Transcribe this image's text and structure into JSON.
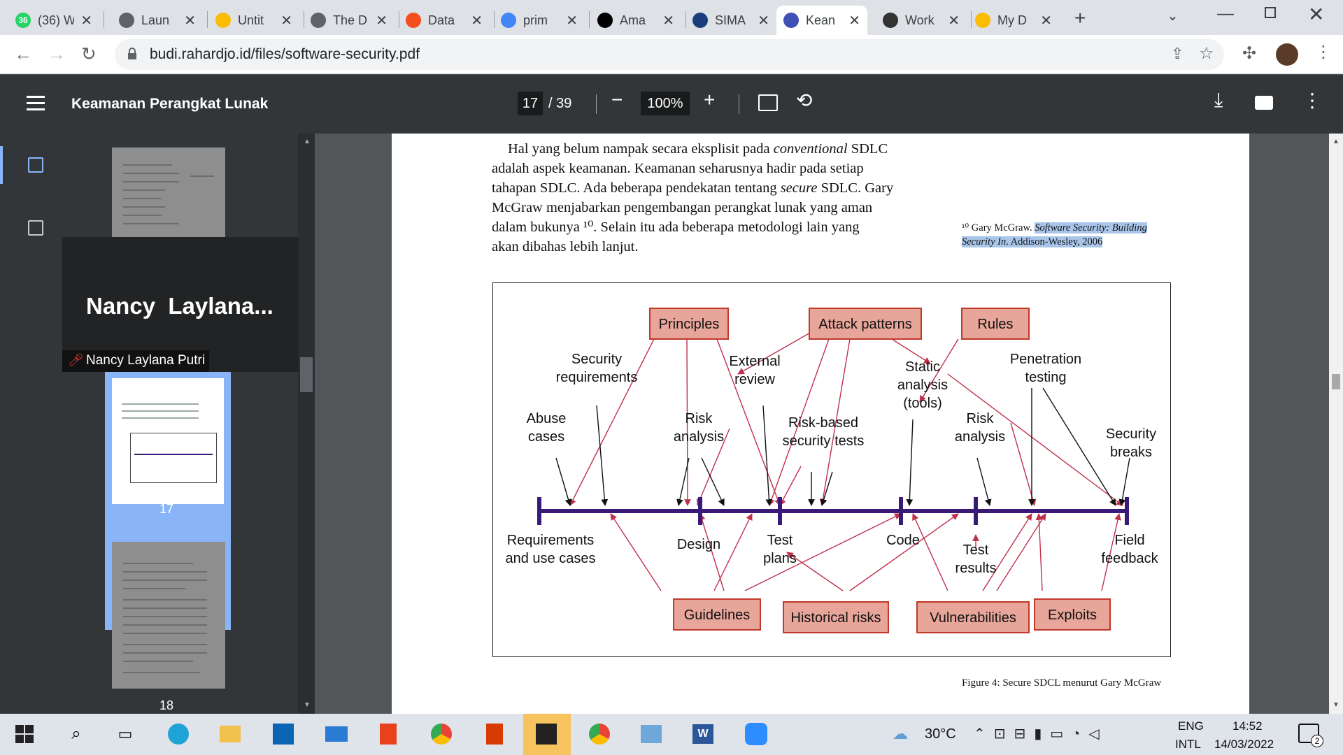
{
  "browser": {
    "tabs": [
      {
        "title": "(36) W",
        "favicon": "whatsapp-icon",
        "color": "#25d366",
        "badge": "36"
      },
      {
        "title": "Laun",
        "favicon": "globe-icon",
        "color": "#5f6368"
      },
      {
        "title": "Untit",
        "favicon": "google-drive-icon",
        "color": "#fbbc04"
      },
      {
        "title": "The D",
        "favicon": "globe-icon",
        "color": "#5f6368"
      },
      {
        "title": "Data",
        "favicon": "figma-icon",
        "color": "#f24e1e"
      },
      {
        "title": "prim",
        "favicon": "google-icon",
        "color": "#4285f4"
      },
      {
        "title": "Ama",
        "favicon": "amazon-icon",
        "color": "#000000"
      },
      {
        "title": "SIMA",
        "favicon": "sima-icon",
        "color": "#1a3d7c"
      },
      {
        "title": "Kean",
        "favicon": "kean-icon",
        "color": "#3f51b5",
        "active": true
      },
      {
        "title": "Work",
        "favicon": "mendeley-icon",
        "color": "#333333"
      },
      {
        "title": "My D",
        "favicon": "google-drive-icon",
        "color": "#fbbc04"
      }
    ],
    "url": "budi.rahardjo.id/files/software-security.pdf"
  },
  "pdf": {
    "title": "Keamanan Perangkat Lunak",
    "current_page": "17",
    "total_pages": "/ 39",
    "zoom": "100%",
    "thumbnails": {
      "current_label": "17",
      "next_label": "18"
    }
  },
  "video_popup": {
    "big_name": "Nancy  Laylana...",
    "participant": "Nancy Laylana Putri"
  },
  "page_content": {
    "line1_a": "Hal yang belum nampak secara eksplisit pada ",
    "line1_i": "conventional",
    "line1_b": " SDLC",
    "line2": "adalah aspek keamanan. Keamanan seharusnya hadir pada setiap",
    "line3_a": "tahapan SDLC. Ada beberapa pendekatan tentang ",
    "line3_i": "secure",
    "line3_b": " SDLC. Gary",
    "line4": "McGraw menjabarkan pengembangan perangkat lunak yang aman",
    "line5": "dalam bukunya ¹⁰. Selain itu ada beberapa metodologi lain yang",
    "line6": "akan dibahas lebih lanjut.",
    "footnote_num": "¹⁰",
    "footnote_author": " Gary McGraw. ",
    "footnote_title": "Software Security: Building Security In",
    "footnote_rest": ". Addison-Wesley, 2006",
    "caption": "Figure 4: Secure SDCL menurut Gary McGraw"
  },
  "diagram": {
    "boxes_top": [
      "Principles",
      "Attack patterns",
      "Rules"
    ],
    "boxes_bottom": [
      "Guidelines",
      "Historical risks",
      "Vulnerabilities",
      "Exploits"
    ],
    "top_labels": [
      "Security\nrequirements",
      "External\nreview",
      "Static\nanalysis\n(tools)",
      "Penetration\ntesting",
      "Abuse\ncases",
      "Risk\nanalysis",
      "Risk-based\nsecurity tests",
      "Risk\nanalysis",
      "Security\nbreaks"
    ],
    "phases": [
      "Requirements\nand use cases",
      "Design",
      "Test\nplans",
      "Code",
      "Test\nresults",
      "Field\nfeedback"
    ],
    "colors": {
      "box_fill": "#e8a59a",
      "box_border": "#c0392b",
      "timeline": "#3a1a78",
      "arrow_red": "#c0304a",
      "arrow_black": "#111111"
    }
  },
  "taskbar": {
    "weather": "30°C",
    "lang1": "ENG",
    "lang2": "INTL",
    "time": "14:52",
    "date": "14/03/2022",
    "notif": "2"
  }
}
